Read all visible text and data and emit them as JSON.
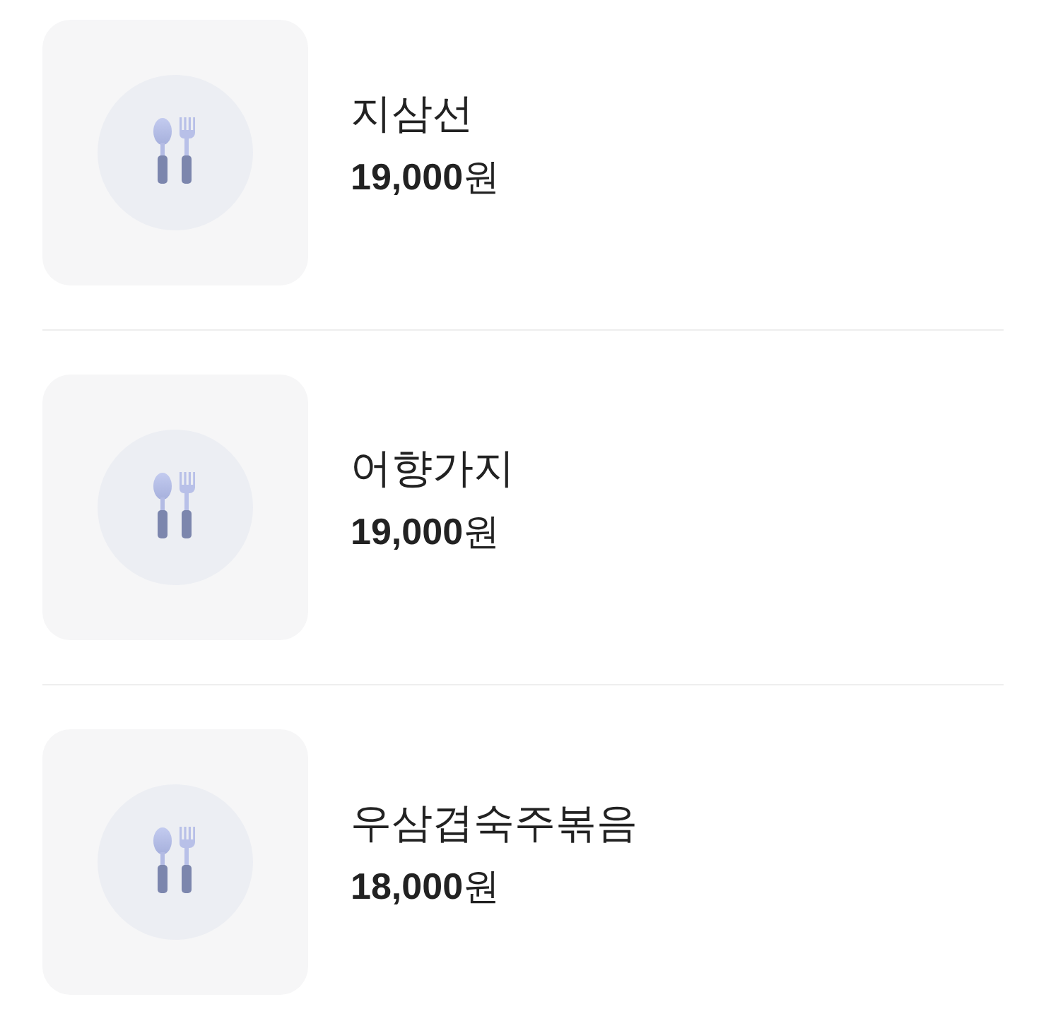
{
  "menu_items": [
    {
      "name": "지삼선",
      "price": "**19,000**원",
      "thumbnail": {
        "kind": "placeholder"
      }
    },
    {
      "name": "어향가지",
      "price": "**19,000**원",
      "thumbnail": {
        "kind": "placeholder"
      }
    },
    {
      "name": "우삼겹숙주볶음",
      "price": "**18,000**원",
      "thumbnail": {
        "kind": "placeholder"
      }
    }
  ]
}
